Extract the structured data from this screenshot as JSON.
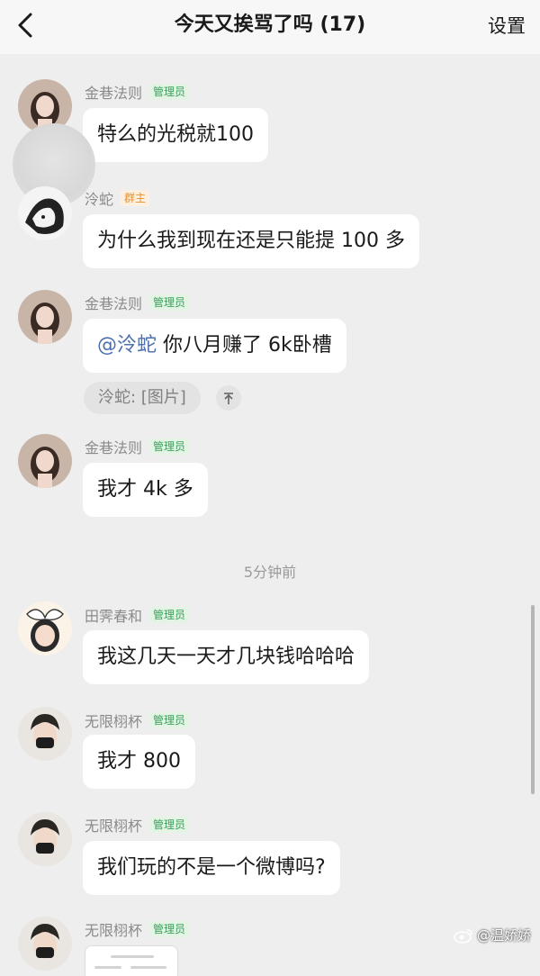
{
  "header": {
    "title": "今天又挨骂了吗 (17)",
    "settings_label": "设置",
    "back_icon": "chevron-left-icon"
  },
  "messages": [
    {
      "sender": "金巷法则",
      "role": "管理员",
      "text": "特么的光税就100"
    },
    {
      "sender": "泠蛇",
      "role": "群主",
      "text": "为什么我到现在还是只能提 100 多"
    },
    {
      "sender": "金巷法则",
      "role": "管理员",
      "mention": "@泠蛇",
      "text": " 你八月赚了 6k卧槽"
    },
    {
      "sender": "金巷法则",
      "role": "管理员",
      "text": "我才 4k 多"
    },
    {
      "sender": "田霁春和",
      "role": "管理员",
      "text": "我这几天一天才几块钱哈哈哈"
    },
    {
      "sender": "无限栩杯",
      "role": "管理员",
      "text": "我才 800"
    },
    {
      "sender": "无限栩杯",
      "role": "管理员",
      "text": "我们玩的不是一个微博吗?"
    },
    {
      "sender": "无限栩杯",
      "role": "管理员"
    }
  ],
  "quote": {
    "text": "泠蛇: [图片]"
  },
  "timestamp": "5分钟前",
  "watermark": {
    "text": "@温娇娇",
    "icon": "weibo-icon"
  },
  "colors": {
    "admin_badge": "#3aa05a",
    "owner_badge": "#e5922f",
    "mention": "#4c6fae",
    "background": "#eeeeee"
  }
}
